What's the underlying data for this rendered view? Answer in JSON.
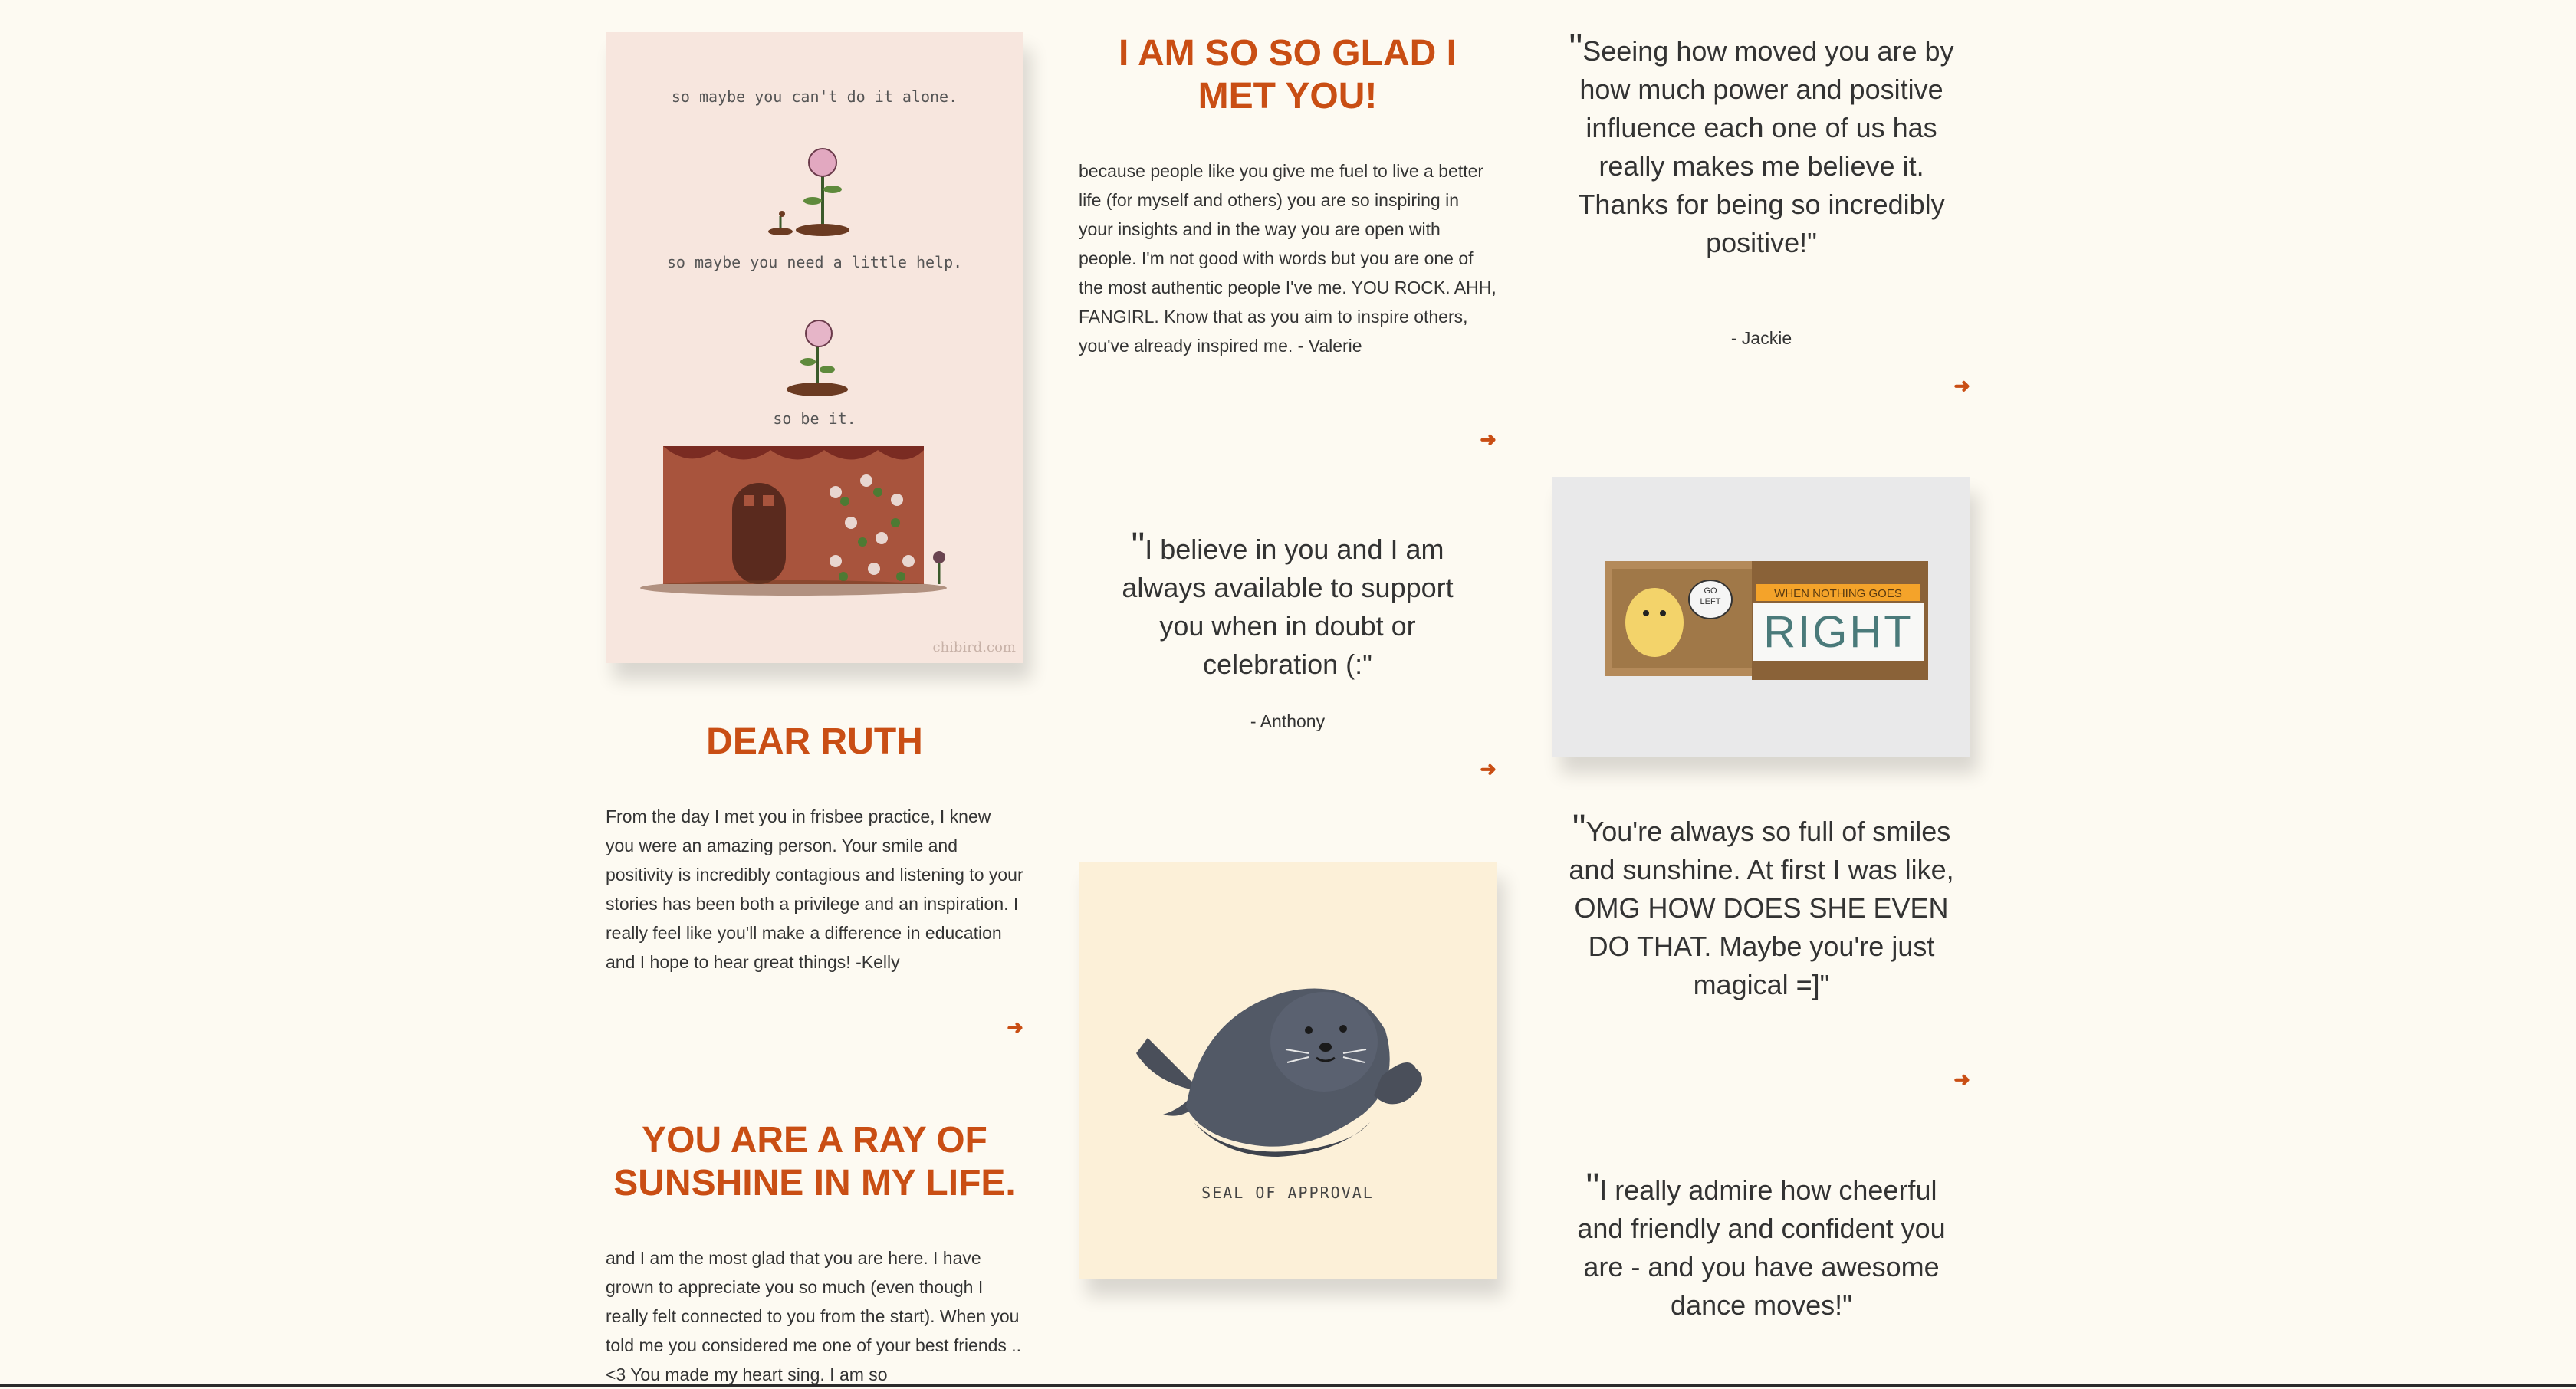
{
  "col1": {
    "image1": {
      "line1": "so maybe you can't do it alone.",
      "line2": "so maybe you need a little help.",
      "line3": "so be it.",
      "watermark": "chibird.com"
    },
    "card1": {
      "title": "DEAR RUTH",
      "body": "From the day I met you in frisbee practice, I knew you were an amazing person. Your smile and positivity is incredibly contagious and listening to your stories has been both a privilege and an inspiration. I really feel like you'll make a difference in education and I hope to hear great things! -Kelly",
      "arrow": "➜"
    },
    "card2": {
      "title": "YOU ARE A RAY OF SUNSHINE IN MY LIFE.",
      "body": "and I am the most glad that you are here. I have grown to appreciate you so much (even though I really felt connected to you from the start). When you told me you considered me one of your best friends .. <3 You made my heart sing. I am so"
    }
  },
  "col2": {
    "card1": {
      "title": "I AM SO SO GLAD I MET YOU!",
      "body": "because people like you give me fuel to live a better life (for myself and others) you are so inspiring in your insights and in the way you are open with people. I'm not good with words but you are one of the most authentic people I've me. YOU ROCK. AHH, FANGIRL. Know that as you aim to inspire others, you've already inspired me. - Valerie",
      "arrow": "➜"
    },
    "card2": {
      "quote": "I believe in you and I am always available to support you when in doubt or celebration (:\"",
      "author": "- Anthony",
      "arrow": "➜"
    },
    "image2": {
      "caption": "SEAL OF APPROVAL"
    }
  },
  "col3": {
    "card1": {
      "quote": "Seeing how moved you are by how much power and positive influence each one of us has really makes me believe it. Thanks for being so incredibly positive!\"",
      "author": "- Jackie",
      "arrow": "➜"
    },
    "image3": {
      "bubble": "GO LEFT",
      "banner": "WHEN NOTHING GOES",
      "big": "RIGHT"
    },
    "card2": {
      "quote": "You're always so full of smiles and sunshine. At first I was like, OMG HOW DOES SHE EVEN DO THAT. Maybe you're just magical =]\"",
      "arrow": "➜"
    },
    "card3": {
      "quote": "I really admire how cheerful and friendly and confident you are - and you have awesome dance moves!\""
    }
  },
  "quote_mark": "\""
}
